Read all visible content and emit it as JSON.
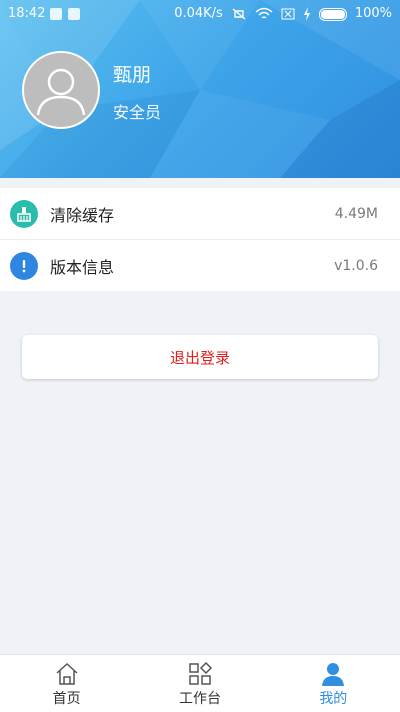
{
  "status_bar": {
    "time": "18:42",
    "network_speed": "0.04K/s",
    "battery_percent": "100%"
  },
  "profile": {
    "name": "甄朋",
    "role": "安全员"
  },
  "menu": [
    {
      "label": "清除缓存",
      "value": "4.49M",
      "icon": "broom-icon",
      "icon_color": "#2bbdab"
    },
    {
      "label": "版本信息",
      "value": "v1.0.6",
      "icon": "info-exclamation-icon",
      "icon_color": "#2f86e0"
    }
  ],
  "logout_label": "退出登录",
  "bottom_nav": [
    {
      "label": "首页",
      "icon": "home-icon",
      "active": false
    },
    {
      "label": "工作台",
      "icon": "workbench-icon",
      "active": false
    },
    {
      "label": "我的",
      "icon": "profile-icon",
      "active": true
    }
  ],
  "colors": {
    "header_accent": "#3fa6ea",
    "active_tab": "#2f8fe0",
    "logout_text": "#e02020",
    "page_bg": "#eff2f7"
  }
}
